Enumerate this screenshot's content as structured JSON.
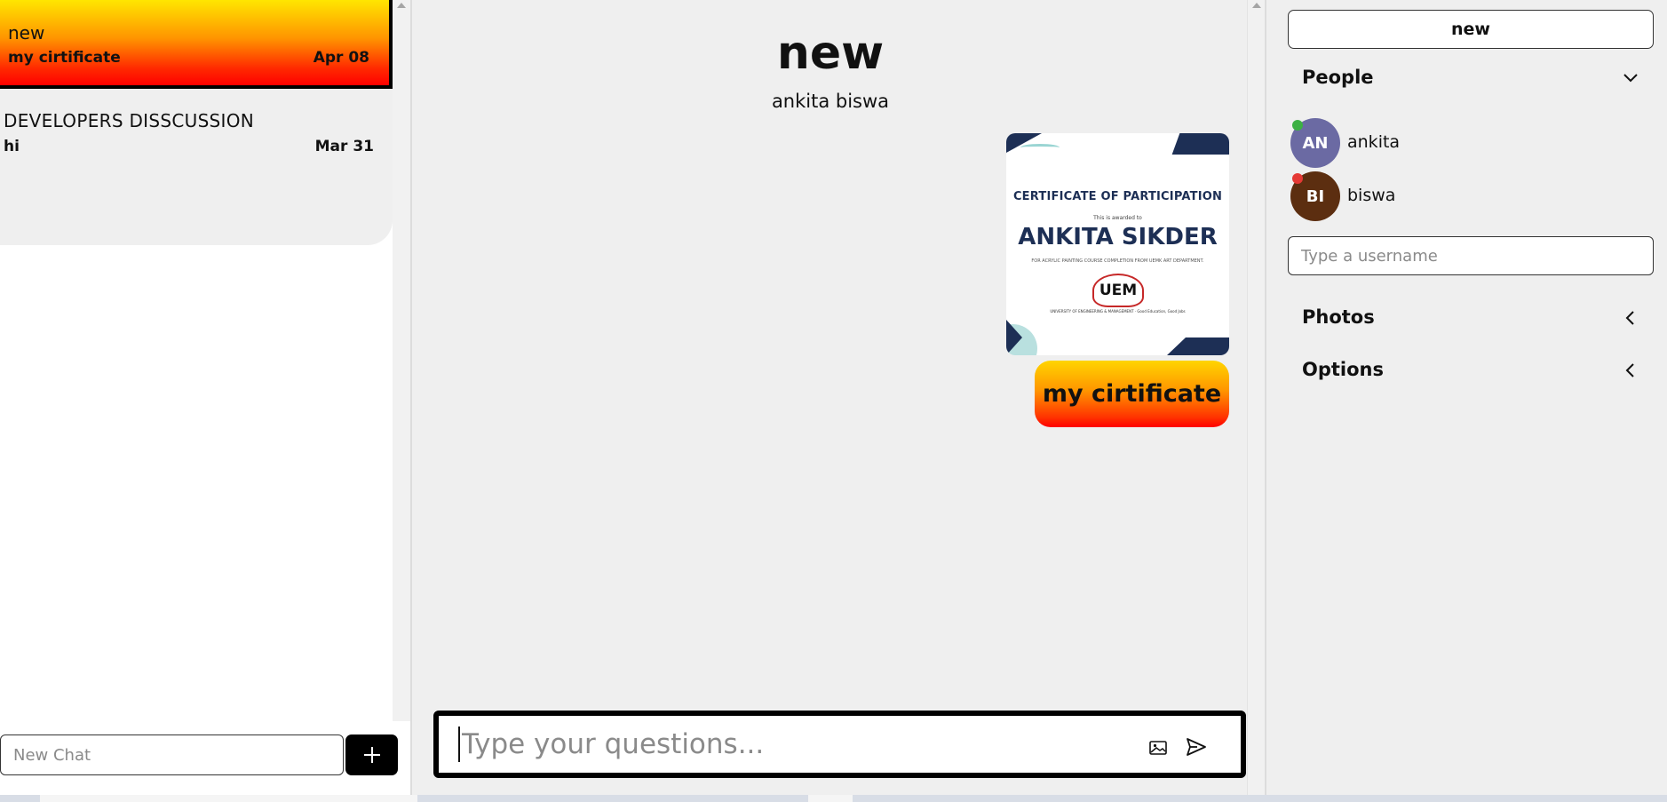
{
  "sidebar": {
    "chats": [
      {
        "title": "new",
        "last_message": "my cirtificate",
        "date": "Apr 08",
        "active": true
      },
      {
        "title": "DEVELOPERS DISSCUSSION",
        "last_message": "hi",
        "date": "Mar 31",
        "active": false
      }
    ],
    "new_chat_placeholder": "New Chat"
  },
  "conversation": {
    "title": "new",
    "members": "ankita biswa",
    "messages": [
      {
        "type": "image",
        "certificate": {
          "heading": "CERTIFICATE OF PARTICIPATION",
          "awarded_line": "This is awarded to",
          "name": "ANKITA SIKDER",
          "description": "FOR ACRYLIC PAINTING COURSE COMPLETION FROM UEMK ART DEPARTMENT.",
          "seal_text": "UEM",
          "footer": "UNIVERSITY OF ENGINEERING & MANAGEMENT · Good Education, Good Jobs"
        }
      },
      {
        "type": "text",
        "text": "my cirtificate"
      }
    ],
    "composer_placeholder": "Type your questions..."
  },
  "details": {
    "new_button_label": "new",
    "people_label": "People",
    "people": [
      {
        "initials": "AN",
        "name": "ankita",
        "online": true,
        "avatar_color": "#6b6aa3",
        "status_color": "#3cb043"
      },
      {
        "initials": "BI",
        "name": "biswa",
        "online": false,
        "avatar_color": "#5c2e10",
        "status_color": "#e53935"
      }
    ],
    "username_placeholder": "Type a username",
    "photos_label": "Photos",
    "options_label": "Options"
  },
  "colors": {
    "accent_gradient_top": "#ffe600",
    "accent_gradient_bottom": "#ff0000",
    "panel_bg": "#efefef"
  }
}
